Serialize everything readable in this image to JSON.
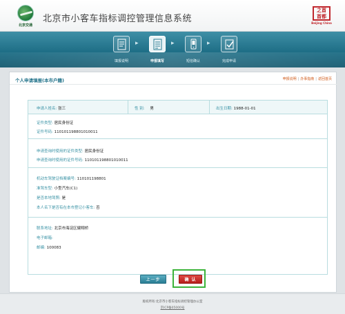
{
  "header": {
    "logo_text": "北京交通",
    "system_title": "北京市小客车指标调控管理信息系统",
    "right_logo_text": "之首\n首都",
    "right_logo_sub": "Beijing China"
  },
  "steps": [
    {
      "label": "填报说明",
      "icon": "document-icon"
    },
    {
      "label": "申报填写",
      "icon": "form-edit-icon"
    },
    {
      "label": "短信确认",
      "icon": "mobile-phone-icon"
    },
    {
      "label": "完成申请",
      "icon": "checkmark-icon"
    }
  ],
  "panel": {
    "title": "个人申请填报(本市户籍)",
    "links": [
      "申报说明",
      "办事指南",
      "返回首页"
    ]
  },
  "form": {
    "applicant_name_label": "申请人姓名:",
    "applicant_name": "张三",
    "gender_label": "性  别:",
    "gender": "男",
    "birth_label": "出生日期:",
    "birth": "1988-01-01",
    "id_type_label": "证件类型:",
    "id_type": "居民身份证",
    "id_number_label": "证件号码:",
    "id_number": "110101198801010011",
    "extra_id_type_label": "申请查询时使用的证件类型:",
    "extra_id_type": "居民身份证",
    "extra_id_number_label": "申请查询时使用的证件号码:",
    "extra_id_number": "110101198801010011",
    "license_no_label": "机动车驾驶证档案编号:",
    "license_no": "110101198801",
    "vehicle_type_label": "准驾车型:",
    "vehicle_type": "小型汽车(C1)",
    "local_driver_label": "是否本地驾照:",
    "local_driver": "是",
    "own_car_label": "本人名下是否有在本市登记小客车:",
    "own_car": "否",
    "address_label": "联系地址:",
    "address": "北京市海淀区健翔桥",
    "email_label": "电子邮箱:",
    "email": "",
    "postcode_label": "邮编:",
    "postcode": "100083"
  },
  "buttons": {
    "prev": "上一步",
    "confirm": "确 认"
  },
  "footer": {
    "line1": "版权所有:北京市小客车指标调控管理办公室",
    "line2": "京ICP备05000号"
  }
}
